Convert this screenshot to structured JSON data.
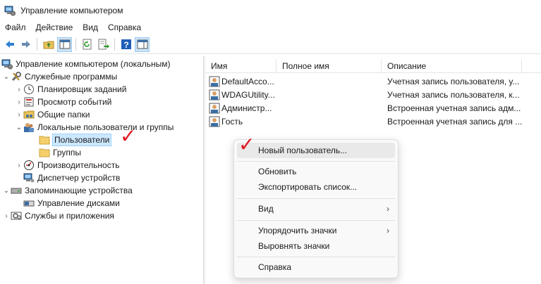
{
  "window": {
    "title": "Управление компьютером"
  },
  "menubar": [
    "Файл",
    "Действие",
    "Вид",
    "Справка"
  ],
  "toolbar": {
    "buttons": [
      "back-icon",
      "forward-icon",
      "up-folder-icon",
      "show-tree-icon",
      "refresh-icon",
      "export-icon",
      "help-icon",
      "properties-icon"
    ]
  },
  "tree": {
    "root": "Управление компьютером (локальным)",
    "system_tools": "Служебные программы",
    "task_scheduler": "Планировщик заданий",
    "event_viewer": "Просмотр событий",
    "shared_folders": "Общие папки",
    "local_users": "Локальные пользователи и группы",
    "users": "Пользователи",
    "groups": "Группы",
    "performance": "Производительность",
    "device_manager": "Диспетчер устройств",
    "storage": "Запоминающие устройства",
    "disk_management": "Управление дисками",
    "services": "Службы и приложения"
  },
  "list": {
    "columns": [
      "Имя",
      "Полное имя",
      "Описание"
    ],
    "rows": [
      {
        "name": "DefaultAcco...",
        "full": "",
        "desc": "Учетная запись пользователя, у..."
      },
      {
        "name": "WDAGUtility...",
        "full": "",
        "desc": "Учетная запись пользователя, к..."
      },
      {
        "name": "Администр...",
        "full": "",
        "desc": "Встроенная учетная запись адм..."
      },
      {
        "name": "Гость",
        "full": "",
        "desc": "Встроенная учетная запись для ..."
      }
    ]
  },
  "context_menu": {
    "new_user": "Новый пользователь...",
    "refresh": "Обновить",
    "export": "Экспортировать список...",
    "view": "Вид",
    "arrange": "Упорядочить значки",
    "align": "Выровнять значки",
    "help": "Справка",
    "submenu_glyph": "›"
  },
  "annotation": {
    "mark": "✓",
    "color": "#e0141e"
  }
}
